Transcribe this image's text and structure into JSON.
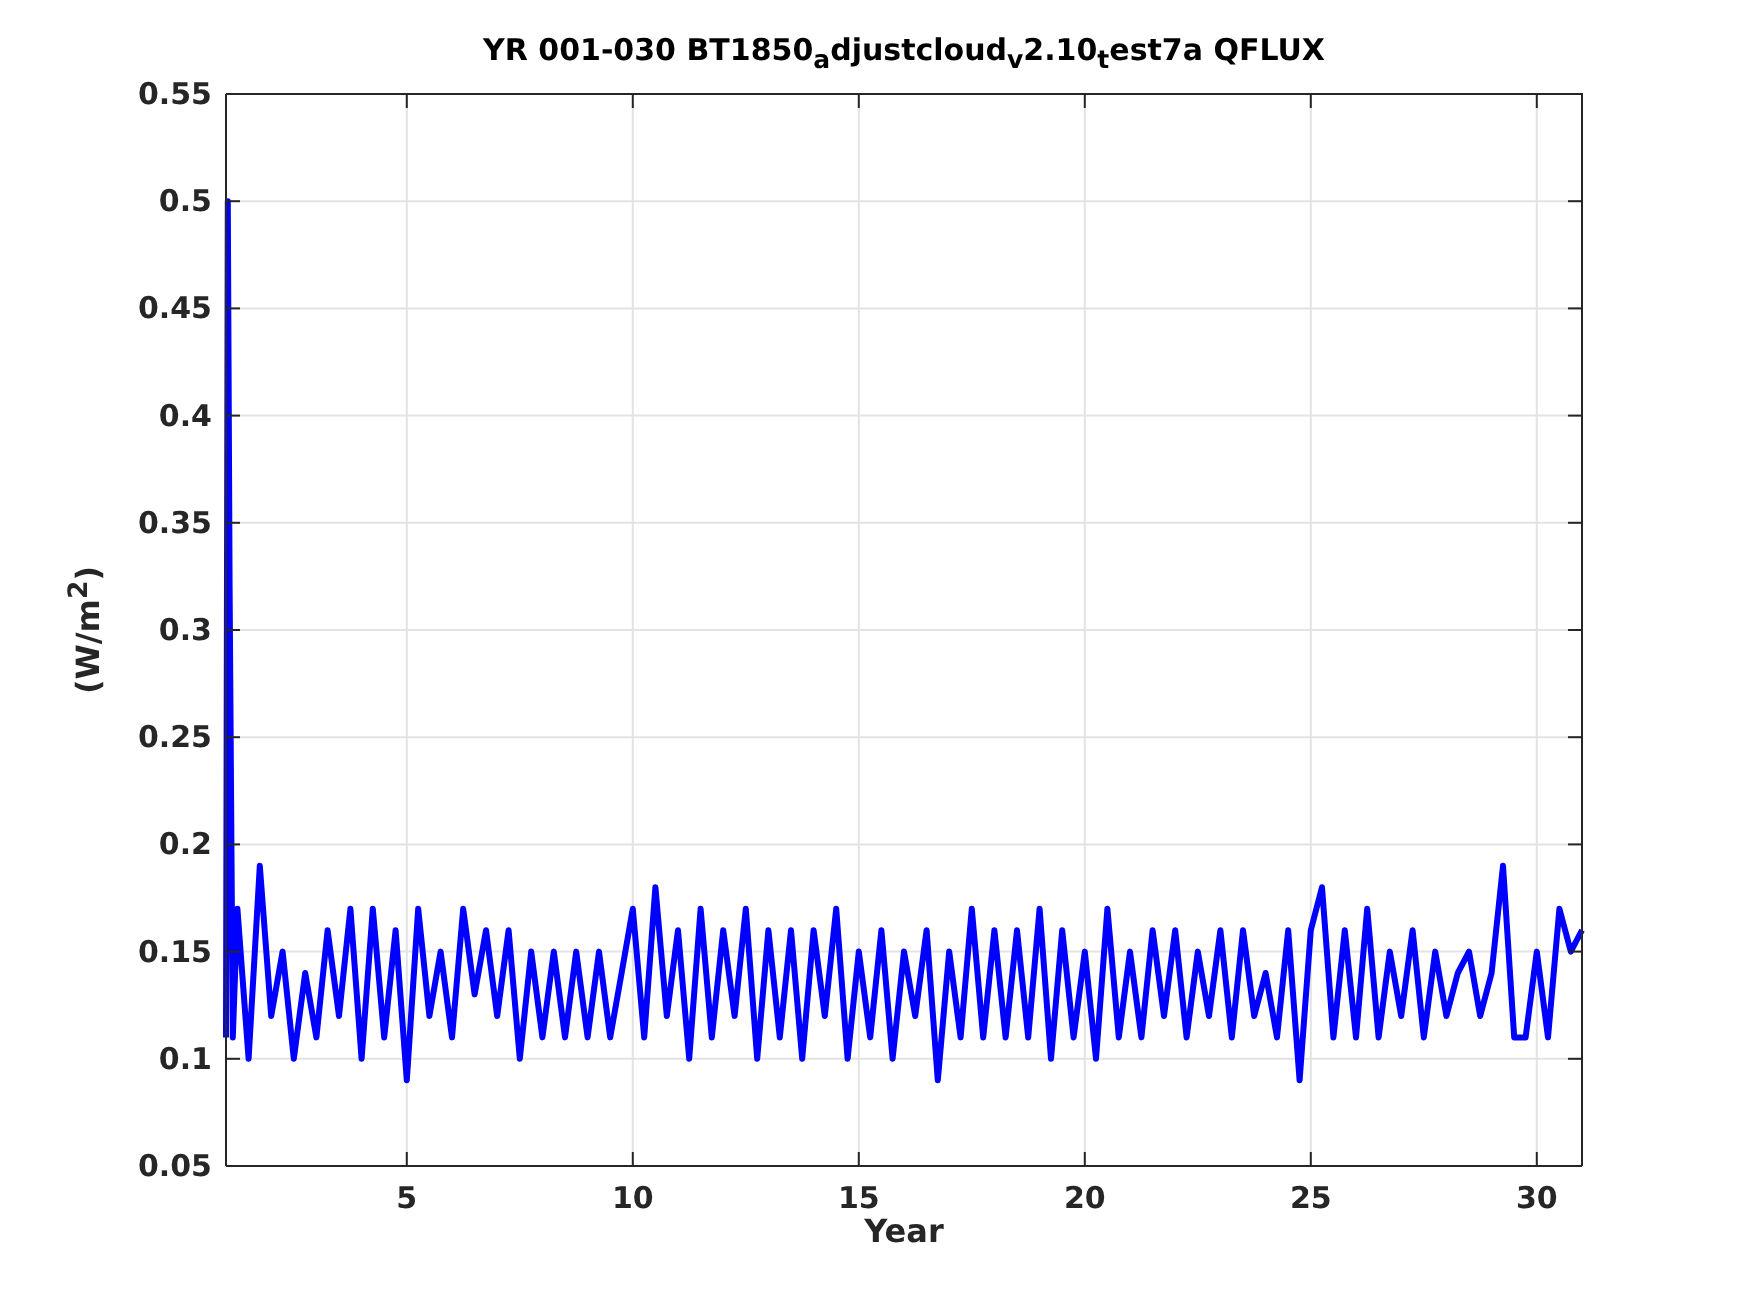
{
  "figure": {
    "chart_data": {
      "type": "line",
      "grid": true,
      "title": "YR 001-030 BT1850$_{a}$djustcloud$_{v}$2.10$_{t}$est7a QFLUX",
      "xlabel": "Year",
      "ylabel": "(W/m$^{2}$)",
      "xlim": [
        1,
        31
      ],
      "ylim": [
        0.05,
        0.55
      ],
      "xticks": [
        5,
        10,
        15,
        20,
        25,
        30
      ],
      "yticks": [
        {
          "value": 0.05,
          "label": "0.05"
        },
        {
          "value": 0.1,
          "label": "0.1"
        },
        {
          "value": 0.15,
          "label": "0.15"
        },
        {
          "value": 0.2,
          "label": "0.2"
        },
        {
          "value": 0.25,
          "label": "0.25"
        },
        {
          "value": 0.3,
          "label": "0.3"
        },
        {
          "value": 0.35,
          "label": "0.35"
        },
        {
          "value": 0.4,
          "label": "0.4"
        },
        {
          "value": 0.45,
          "label": "0.45"
        },
        {
          "value": 0.5,
          "label": "0.5"
        },
        {
          "value": 0.55,
          "label": "0.55"
        }
      ],
      "x": [
        1,
        1.04,
        1.08,
        1.15,
        1.25,
        1.5,
        1.75,
        2,
        2.25,
        2.5,
        2.75,
        3,
        3.25,
        3.5,
        3.75,
        4,
        4.25,
        4.5,
        4.75,
        5,
        5.25,
        5.5,
        5.75,
        6,
        6.25,
        6.5,
        6.75,
        7,
        7.25,
        7.5,
        7.75,
        8,
        8.25,
        8.5,
        8.75,
        9,
        9.25,
        9.5,
        9.75,
        10,
        10.25,
        10.5,
        10.75,
        11,
        11.25,
        11.5,
        11.75,
        12,
        12.25,
        12.5,
        12.75,
        13,
        13.25,
        13.5,
        13.75,
        14,
        14.25,
        14.5,
        14.75,
        15,
        15.25,
        15.5,
        15.75,
        16,
        16.25,
        16.5,
        16.75,
        17,
        17.25,
        17.5,
        17.75,
        18,
        18.25,
        18.5,
        18.75,
        19,
        19.25,
        19.5,
        19.75,
        20,
        20.25,
        20.5,
        20.75,
        21,
        21.25,
        21.5,
        21.75,
        22,
        22.25,
        22.5,
        22.75,
        23,
        23.25,
        23.5,
        23.75,
        24,
        24.25,
        24.5,
        24.75,
        25,
        25.25,
        25.5,
        25.75,
        26,
        26.25,
        26.5,
        26.75,
        27,
        27.25,
        27.5,
        27.75,
        28,
        28.25,
        28.5,
        28.75,
        29,
        29.25,
        29.5,
        29.75,
        30,
        30.25,
        30.5,
        30.75,
        31
      ],
      "series": [
        {
          "color": "#0000ff",
          "values": [
            0.11,
            0.5,
            0.32,
            0.11,
            0.17,
            0.1,
            0.19,
            0.12,
            0.15,
            0.1,
            0.14,
            0.11,
            0.16,
            0.12,
            0.17,
            0.1,
            0.17,
            0.11,
            0.16,
            0.09,
            0.17,
            0.12,
            0.15,
            0.11,
            0.17,
            0.13,
            0.16,
            0.12,
            0.16,
            0.1,
            0.15,
            0.11,
            0.15,
            0.11,
            0.15,
            0.11,
            0.15,
            0.11,
            0.14,
            0.17,
            0.11,
            0.18,
            0.12,
            0.16,
            0.1,
            0.17,
            0.11,
            0.16,
            0.12,
            0.17,
            0.1,
            0.16,
            0.11,
            0.16,
            0.1,
            0.16,
            0.12,
            0.17,
            0.1,
            0.15,
            0.11,
            0.16,
            0.1,
            0.15,
            0.12,
            0.16,
            0.09,
            0.15,
            0.11,
            0.17,
            0.11,
            0.16,
            0.11,
            0.16,
            0.11,
            0.17,
            0.1,
            0.16,
            0.11,
            0.15,
            0.1,
            0.17,
            0.11,
            0.15,
            0.11,
            0.16,
            0.12,
            0.16,
            0.11,
            0.15,
            0.12,
            0.16,
            0.11,
            0.16,
            0.12,
            0.14,
            0.11,
            0.16,
            0.09,
            0.16,
            0.18,
            0.11,
            0.16,
            0.11,
            0.17,
            0.11,
            0.15,
            0.12,
            0.16,
            0.11,
            0.15,
            0.12,
            0.14,
            0.15,
            0.12,
            0.14,
            0.19,
            0.11,
            0.11,
            0.15,
            0.11,
            0.17,
            0.15,
            0.16
          ]
        }
      ]
    }
  }
}
